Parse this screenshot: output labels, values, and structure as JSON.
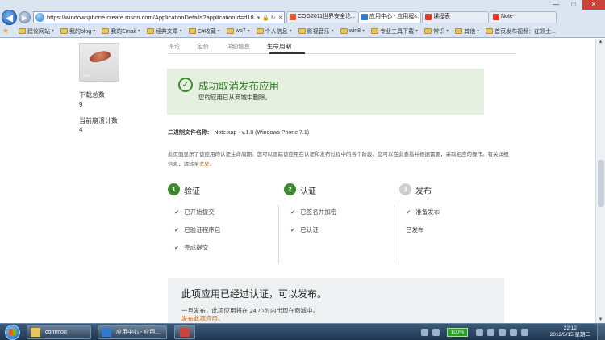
{
  "window": {
    "minimize": "—",
    "maximize": "□",
    "close": "✕"
  },
  "browser": {
    "back_icon": "arrow-left-icon",
    "forward_icon": "arrow-right-icon",
    "address": "https://windowsphone.create.msdn.com/ApplicationDetails?applicationId=d18",
    "tabs": [
      {
        "label": "COG2011世界安全论...",
        "icon_color": "#e25c2c",
        "active": false
      },
      {
        "label": "应用中心 - 应用程...",
        "icon_color": "#2f7bd0",
        "active": true
      },
      {
        "label": "课程表",
        "icon_color": "#d83b2a",
        "active": false
      },
      {
        "label": "Note",
        "icon_color": "#d83b2a",
        "active": false
      }
    ],
    "favorites": [
      "建议网站",
      "我的blog",
      "我的Email",
      "经典文章",
      "C#收藏",
      "wp7",
      "个人信息",
      "影视音乐",
      "win8",
      "专业工具下载",
      "常识",
      "其他",
      "首页发布视频：在领土..."
    ]
  },
  "sidebar": {
    "thumb_text": "Note",
    "downloads_label": "下载总数",
    "downloads_value": "9",
    "crashes_label": "当前崩溃计数",
    "crashes_value": "4"
  },
  "tabs": [
    {
      "label": "评论",
      "active": false
    },
    {
      "label": "定价",
      "active": false
    },
    {
      "label": "详细信息",
      "active": false
    },
    {
      "label": "生命周期",
      "active": true
    }
  ],
  "success": {
    "title": "成功取消发布应用",
    "subtitle": "您的应用已从商城中删除。"
  },
  "binary": {
    "label": "二进制文件名称:",
    "value": "Note.xap - v.1.0 (Windows Phone 7.1)"
  },
  "description": {
    "text1": "此页面显示了该应用的认证生命周期。您可以跟踪该应用在认证和发布过程中的各个阶段。您可以在此查看并根据需要，采取相应的操作。有关详细信息，请转至",
    "link": "此处",
    "text2": "。"
  },
  "stages": [
    {
      "num": "1",
      "title": "验证",
      "status": "done",
      "items": [
        "已开始提交",
        "已验证程序包",
        "完成提交"
      ]
    },
    {
      "num": "2",
      "title": "认证",
      "status": "done",
      "items": [
        "已签名并加密",
        "已认证"
      ]
    },
    {
      "num": "3",
      "title": "发布",
      "status": "pending",
      "items": [
        "准备发布",
        "已发布"
      ]
    }
  ],
  "certified": {
    "title": "此项应用已经过认证，可以发布。",
    "subtitle": "一旦发布，此项应用将在 24 小时内出现在商城中。",
    "link": "发布此项应用。"
  },
  "taskbar": {
    "items": [
      {
        "label": "common",
        "icon_color": "#e8c75a"
      },
      {
        "label": "应用中心 - 应用...",
        "icon_color": "#2f7bd0"
      },
      {
        "label": "",
        "icon_color": "#c9443b"
      }
    ],
    "battery": "100%",
    "time": "22:12",
    "date": "2012/5/15 星期二"
  },
  "colors": {
    "accent_green": "#3b8a2c",
    "link_orange": "#c96a13",
    "success_bg": "#e6f0e1"
  }
}
